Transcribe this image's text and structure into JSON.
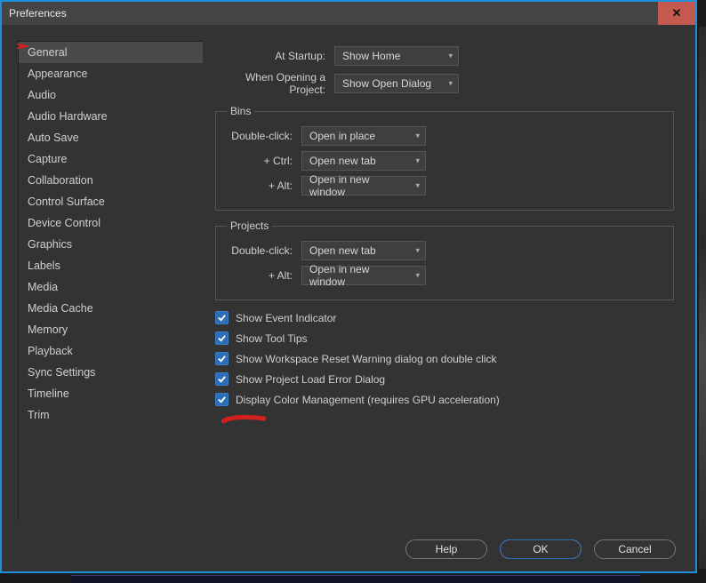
{
  "window": {
    "title": "Preferences"
  },
  "sidebar": {
    "items": [
      "General",
      "Appearance",
      "Audio",
      "Audio Hardware",
      "Auto Save",
      "Capture",
      "Collaboration",
      "Control Surface",
      "Device Control",
      "Graphics",
      "Labels",
      "Media",
      "Media Cache",
      "Memory",
      "Playback",
      "Sync Settings",
      "Timeline",
      "Trim"
    ],
    "selected_index": 0
  },
  "top_rows": [
    {
      "label": "At Startup:",
      "value": "Show Home"
    },
    {
      "label": "When Opening a Project:",
      "value": "Show Open Dialog"
    }
  ],
  "groups": [
    {
      "legend": "Bins",
      "rows": [
        {
          "label": "Double-click:",
          "value": "Open in place"
        },
        {
          "label": "+ Ctrl:",
          "value": "Open new tab"
        },
        {
          "label": "+ Alt:",
          "value": "Open in new window"
        }
      ]
    },
    {
      "legend": "Projects",
      "rows": [
        {
          "label": "Double-click:",
          "value": "Open new tab"
        },
        {
          "label": "+ Alt:",
          "value": "Open in new window"
        }
      ]
    }
  ],
  "checks": [
    {
      "label": "Show Event Indicator",
      "checked": true
    },
    {
      "label": "Show Tool Tips",
      "checked": true
    },
    {
      "label": "Show Workspace Reset Warning dialog on double click",
      "checked": true
    },
    {
      "label": "Show Project Load Error Dialog",
      "checked": true
    },
    {
      "label": "Display Color Management (requires GPU acceleration)",
      "checked": true
    }
  ],
  "footer": {
    "help": "Help",
    "ok": "OK",
    "cancel": "Cancel"
  }
}
